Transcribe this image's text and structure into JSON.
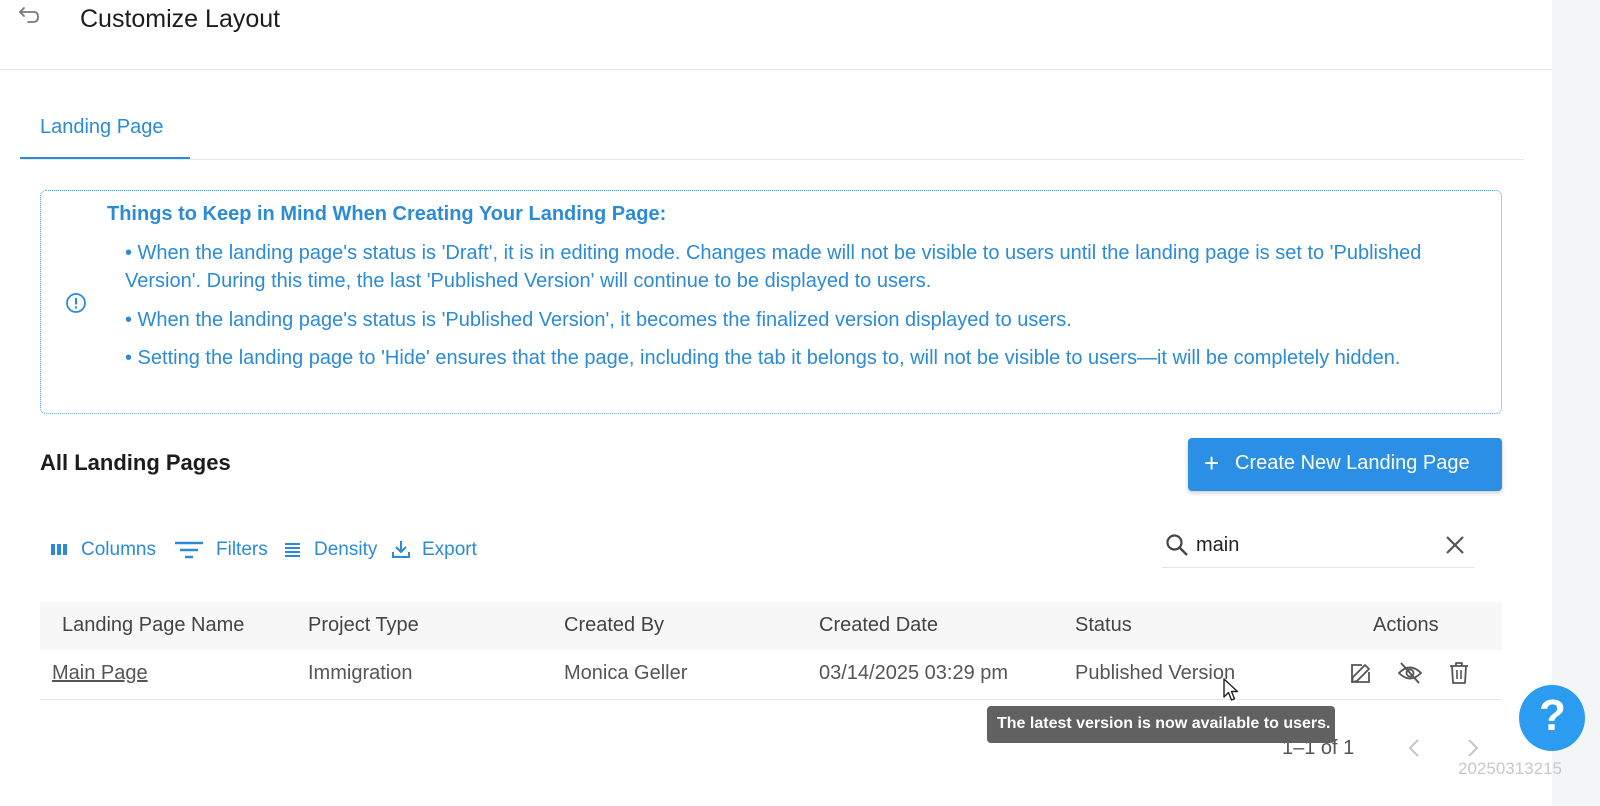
{
  "header": {
    "title": "Customize Layout"
  },
  "tabs": [
    {
      "label": "Landing Page",
      "active": true
    }
  ],
  "info": {
    "title": "Things to Keep in Mind When Creating Your Landing Page:",
    "lines": [
      "• When the landing page's status is 'Draft', it is in editing mode. Changes made will not be visible to users until the landing page is set to 'Published Version'. During this time, the last 'Published Version' will continue to be displayed to users.",
      "• When the landing page's status is 'Published Version', it becomes the finalized version displayed to users.",
      "• Setting the landing page to 'Hide' ensures that the page, including the tab it belongs to, will not be visible to users—it will be completely hidden."
    ]
  },
  "section": {
    "title": "All Landing Pages",
    "create_button": "Create New Landing Page"
  },
  "toolbar": {
    "columns": "Columns",
    "filters": "Filters",
    "density": "Density",
    "export": "Export"
  },
  "search": {
    "value": "main"
  },
  "table": {
    "headers": [
      "Landing Page Name",
      "Project Type",
      "Created By",
      "Created Date",
      "Status",
      "Actions"
    ],
    "rows": [
      {
        "name": "Main Page",
        "project_type": "Immigration",
        "created_by": "Monica Geller",
        "created_date": "03/14/2025 03:29 pm",
        "status": "Published Version"
      }
    ]
  },
  "tooltip": "The latest version is now available to users.",
  "pagination": {
    "label": "1–1 of 1"
  },
  "help": {
    "label": "?"
  },
  "watermark": "20250313215",
  "colors": {
    "accent": "#2b8bd6",
    "button": "#2b8fe5",
    "tooltip_bg": "#616161"
  }
}
